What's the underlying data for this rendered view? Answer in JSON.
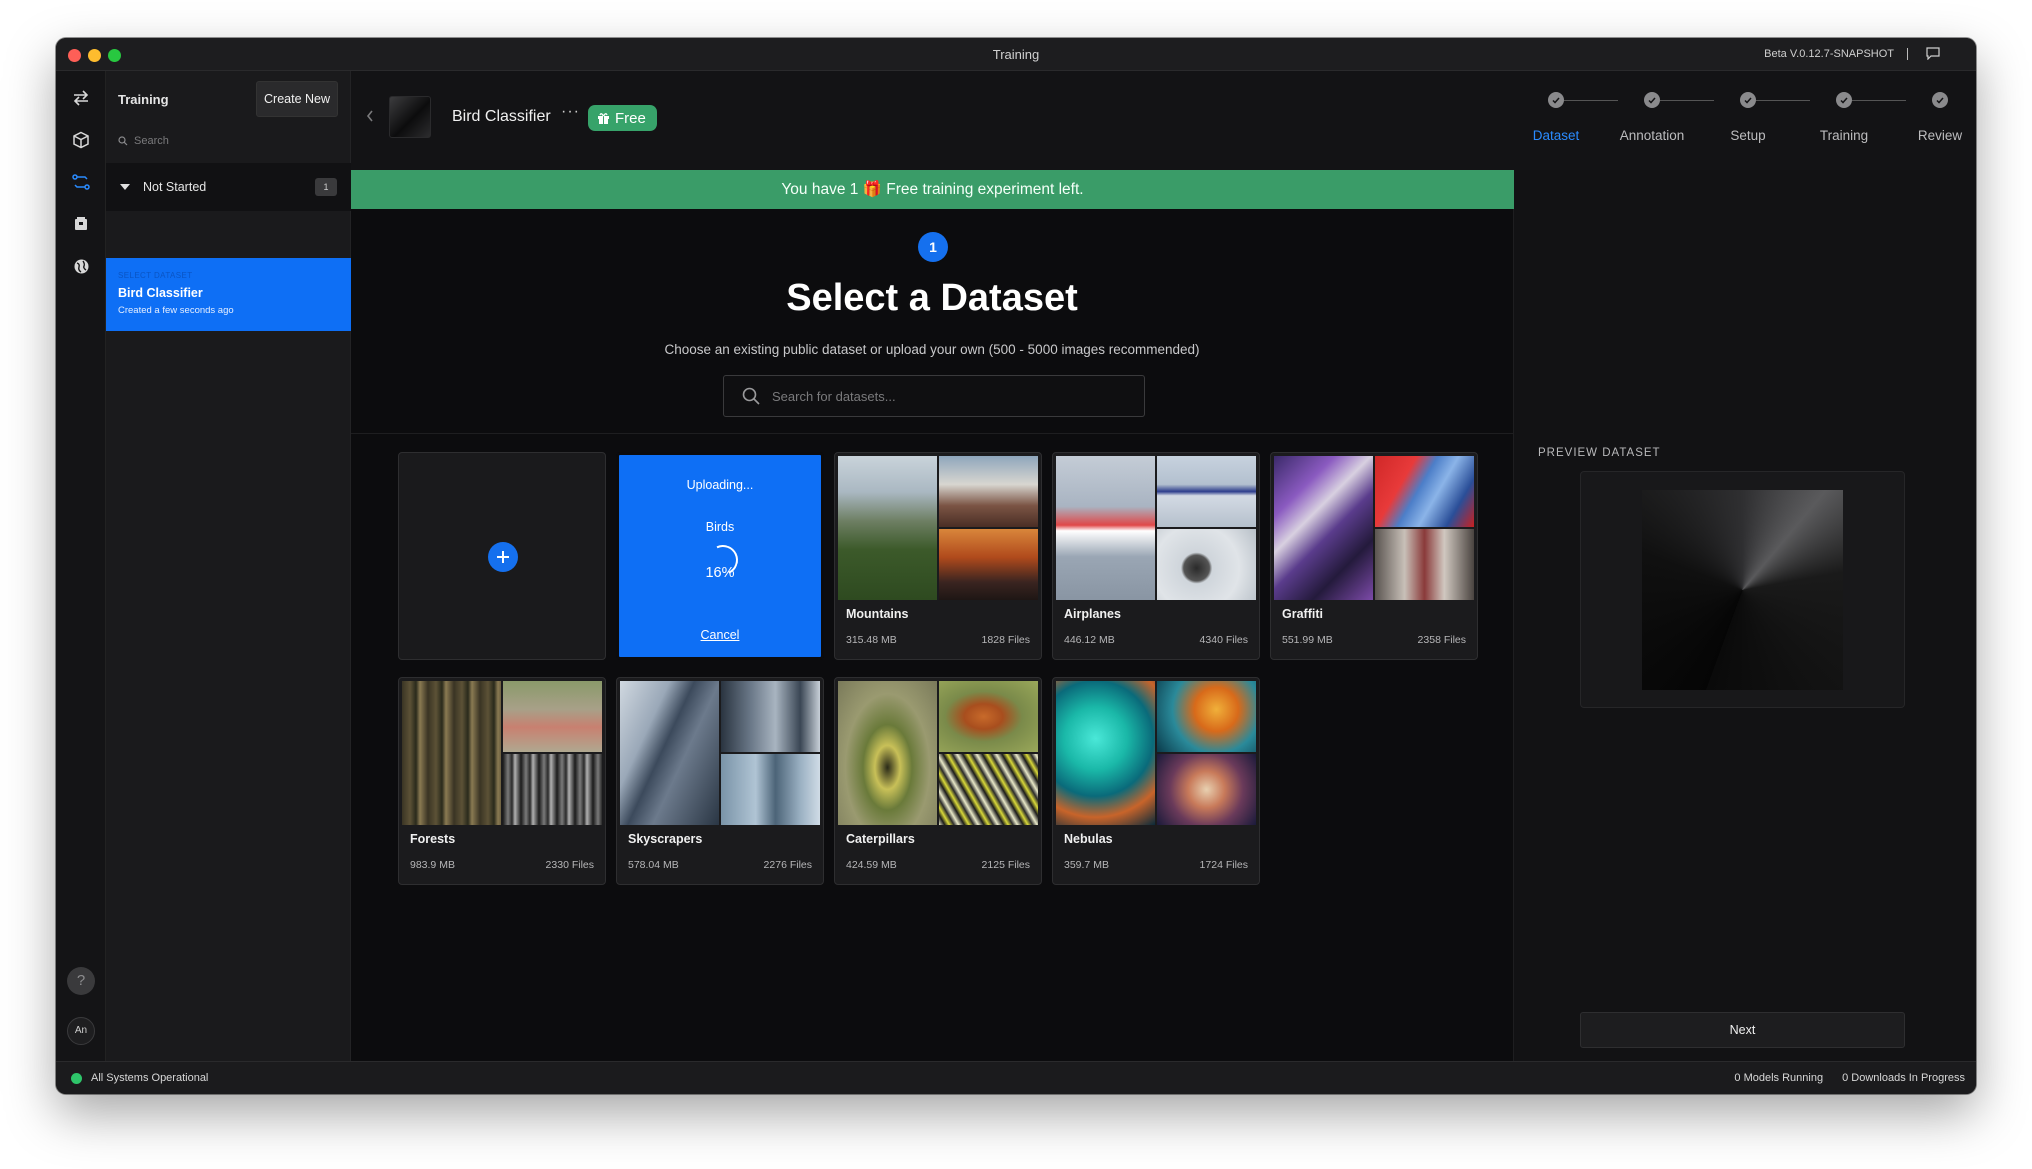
{
  "window": {
    "title": "Training",
    "version": "Beta V.0.12.7-SNAPSHOT"
  },
  "sidebar": {
    "title": "Training",
    "create_label": "Create New",
    "search_placeholder": "Search",
    "group": {
      "label": "Not Started",
      "count": "1"
    },
    "project": {
      "kicker": "SELECT DATASET",
      "name": "Bird Classifier",
      "subtitle": "Created a few seconds ago"
    }
  },
  "rail": {
    "help": "?",
    "avatar": "An"
  },
  "header": {
    "project_name": "Bird Classifier",
    "more": "···",
    "badge": "Free",
    "steps": [
      {
        "label": "Dataset",
        "active": true
      },
      {
        "label": "Annotation",
        "active": false
      },
      {
        "label": "Setup",
        "active": false
      },
      {
        "label": "Training",
        "active": false
      },
      {
        "label": "Review",
        "active": false
      }
    ]
  },
  "banner": {
    "text": "You have 1 🎁 Free training experiment left."
  },
  "main": {
    "step_number": "1",
    "heading": "Select a Dataset",
    "subheading": "Choose an existing public dataset or upload your own (500 - 5000 images recommended)",
    "search_placeholder": "Search for datasets...",
    "upload": {
      "title": "Uploading...",
      "name": "Birds",
      "percent": "16%",
      "progress": 0.16,
      "cancel_label": "Cancel"
    },
    "datasets": [
      {
        "title": "Mountains",
        "size": "315.48 MB",
        "files": "1828 Files"
      },
      {
        "title": "Airplanes",
        "size": "446.12 MB",
        "files": "4340 Files"
      },
      {
        "title": "Graffiti",
        "size": "551.99 MB",
        "files": "2358 Files"
      },
      {
        "title": "Forests",
        "size": "983.9 MB",
        "files": "2330 Files"
      },
      {
        "title": "Skyscrapers",
        "size": "578.04 MB",
        "files": "2276 Files"
      },
      {
        "title": "Caterpillars",
        "size": "424.59 MB",
        "files": "2125 Files"
      },
      {
        "title": "Nebulas",
        "size": "359.7 MB",
        "files": "1724 Files"
      }
    ]
  },
  "right_panel": {
    "preview_label": "PREVIEW DATASET",
    "next_label": "Next"
  },
  "statusbar": {
    "status": "All Systems Operational",
    "models": "0 Models Running",
    "downloads": "0 Downloads In Progress"
  },
  "colors": {
    "accent": "#0e6ff5",
    "banner": "#3a9c68",
    "status_ok": "#2ec56a"
  },
  "icons": {
    "rail": [
      "swap-icon",
      "cube-icon",
      "training-icon",
      "package-icon",
      "globe-icon"
    ]
  }
}
